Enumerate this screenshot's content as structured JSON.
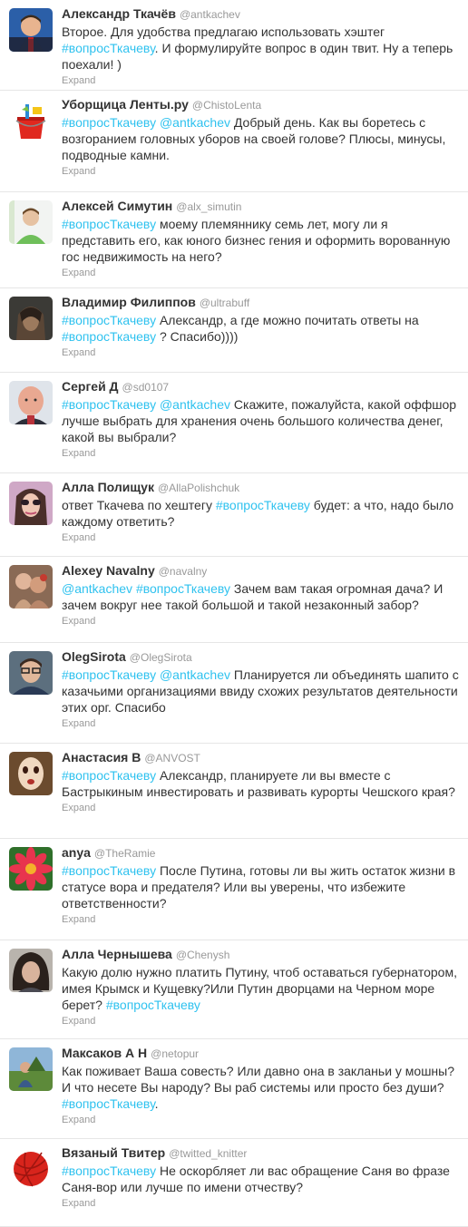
{
  "tweets": [
    {
      "id": "t1",
      "name": "Александр Ткачёв",
      "handle": "@antkachev",
      "parts": [
        {
          "t": "Второе. Для удобства предлагаю использовать хэштег "
        },
        {
          "t": "#вопросТкачеву",
          "link": true
        },
        {
          "t": ". И формулируйте вопрос в один твит. Ну а теперь поехали! )"
        }
      ],
      "expand": "Expand",
      "avatar": "avatar-man-red-tie",
      "h": 100
    },
    {
      "id": "t2",
      "name": "Уборщица Ленты.ру",
      "handle": "@ChistoLenta",
      "parts": [
        {
          "t": "#вопросТкачеву",
          "link": true
        },
        {
          "t": " "
        },
        {
          "t": "@antkachev",
          "link": true
        },
        {
          "t": " Добрый день. Как вы боретесь с возгоранием головных уборов на своей голове? Плюсы, минусы, подводные камни."
        }
      ],
      "expand": "Expand",
      "avatar": "avatar-bucket",
      "h": 112
    },
    {
      "id": "t3",
      "name": "Алексей Симутин",
      "handle": "@alx_simutin",
      "parts": [
        {
          "t": "#вопросТкачеву",
          "link": true
        },
        {
          "t": " моему племяннику семь лет, могу ли я представить его, как юного бизнес гения и оформить ворованную гос недвижимость на него?"
        }
      ],
      "expand": "Expand",
      "avatar": "avatar-man-green",
      "h": 106
    },
    {
      "id": "t4",
      "name": "Владимир Филиппов",
      "handle": "@ultrabuff",
      "parts": [
        {
          "t": "#вопросТкачеву",
          "link": true
        },
        {
          "t": " Александр, а где можно почитать ответы на "
        },
        {
          "t": "#вопросТкачеву",
          "link": true
        },
        {
          "t": " ? Спасибо))))"
        }
      ],
      "expand": "Expand",
      "avatar": "avatar-dark-portrait",
      "h": 93
    },
    {
      "id": "t5",
      "name": "Сергей Д",
      "handle": "@sd0107",
      "parts": [
        {
          "t": "#вопросТкачеву",
          "link": true
        },
        {
          "t": " "
        },
        {
          "t": "@antkachev",
          "link": true
        },
        {
          "t": " Скажите, пожалуйста, какой оффшор лучше выбрать для хранения очень большого количества денег, какой вы выбрали?"
        }
      ],
      "expand": "Expand",
      "avatar": "avatar-bald-man",
      "h": 111
    },
    {
      "id": "t6",
      "name": "Алла Полищук",
      "handle": "@AllaPolishchuk",
      "parts": [
        {
          "t": "ответ Ткачева по хештегу "
        },
        {
          "t": "#вопросТкачеву",
          "link": true
        },
        {
          "t": " будет: а что, надо было каждому ответить?"
        }
      ],
      "expand": "Expand",
      "avatar": "avatar-woman-sunglasses",
      "h": 92
    },
    {
      "id": "t7",
      "name": "Alexey Navalny",
      "handle": "@navalny",
      "parts": [
        {
          "t": "@antkachev",
          "link": true
        },
        {
          "t": " "
        },
        {
          "t": "#вопросТкачеву",
          "link": true
        },
        {
          "t": " Зачем вам такая огромная дача? И зачем вокруг нее такой большой и такой незаконный забор?"
        }
      ],
      "expand": "Expand",
      "avatar": "avatar-fighters",
      "h": 95
    },
    {
      "id": "t8",
      "name": "OlegSirota",
      "handle": "@OlegSirota",
      "parts": [
        {
          "t": "#вопросТкачеву",
          "link": true
        },
        {
          "t": " "
        },
        {
          "t": "@antkachev",
          "link": true
        },
        {
          "t": " Планируется ли объединять шапито с казачьими организациями ввиду схожих результатов деятельности этих орг. Спасибо"
        }
      ],
      "expand": "Expand",
      "avatar": "avatar-man-glasses",
      "h": 111
    },
    {
      "id": "t9",
      "name": "Анастасия В",
      "handle": "@ANVOST",
      "parts": [
        {
          "t": "#вопросТкачеву",
          "link": true
        },
        {
          "t": " Александр, планируете ли вы вместе с Бастрыкиным инвестировать и развивать курорты Чешского края?"
        }
      ],
      "expand": "Expand",
      "avatar": "avatar-mask",
      "h": 105
    },
    {
      "id": "t10",
      "name": "anya",
      "handle": "@TheRamie",
      "parts": [
        {
          "t": "#вопросТкачеву",
          "link": true
        },
        {
          "t": " После Путина, готовы ли вы жить остаток жизни в статусе вора и предателя? Или вы уверены, что избежите ответственности?"
        }
      ],
      "expand": "Expand",
      "avatar": "avatar-flower",
      "h": 112
    },
    {
      "id": "t11",
      "name": "Алла Чернышева",
      "handle": "@Chenysh",
      "parts": [
        {
          "t": "Какую долю нужно платить Путину, чтоб оставаться губернатором, имея Крымск и Кущевку?Или Путин дворцами на Черном море берет? "
        },
        {
          "t": "#вопросТкачеву",
          "link": true
        }
      ],
      "expand": "Expand",
      "avatar": "avatar-woman-curly",
      "h": 109
    },
    {
      "id": "t12",
      "name": "Максаков А Н",
      "handle": "@netopur",
      "parts": [
        {
          "t": "Как поживает Ваша совесть? Или давно она в закланьи у мошны?И что несете Вы народу? Вы раб системы или просто без души? "
        },
        {
          "t": "#вопросТкачеву",
          "link": true
        },
        {
          "t": "."
        }
      ],
      "expand": "Expand",
      "avatar": "avatar-outdoor",
      "h": 110
    },
    {
      "id": "t13",
      "name": "Вязаный Твитер",
      "handle": "@twitted_knitter",
      "parts": [
        {
          "t": "#вопросТкачеву",
          "link": true
        },
        {
          "t": " Не оскорбляет ли вас обращение Саня во фразе Саня-вор или лучше по имени отчеству?"
        }
      ],
      "expand": "Expand",
      "avatar": "avatar-yarn-ball",
      "h": 97
    }
  ],
  "colors": {
    "link": "#2fc2ef",
    "name": "#333333",
    "meta": "#999999",
    "divider": "#e6e6e6"
  }
}
